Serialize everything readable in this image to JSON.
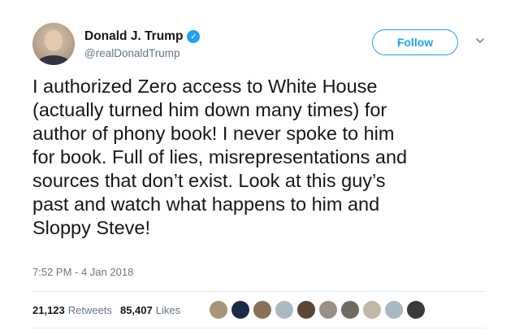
{
  "author": {
    "name": "Donald J. Trump",
    "handle": "@realDonaldTrump",
    "verified_icon": "verified-check-icon",
    "avatar": "profile-avatar"
  },
  "actions": {
    "follow_label": "Follow",
    "menu_icon": "chevron-down-icon"
  },
  "tweet": {
    "lines": [
      "I authorized Zero access to White House",
      "(actually turned him down many times) for",
      "author of phony book! I never spoke to him",
      "for book. Full of lies, misrepresentations and",
      "sources that don’t exist. Look at this guy’s",
      "past and watch what happens to him and",
      "Sloppy Steve!"
    ],
    "timestamp": "7:52 PM - 4 Jan 2018"
  },
  "stats": {
    "retweets_count": "21,123",
    "retweets_label": "Retweets",
    "likes_count": "85,407",
    "likes_label": "Likes"
  },
  "likers": [
    {
      "color": "#a89478"
    },
    {
      "color": "#1c2a4a"
    },
    {
      "color": "#8a6f5a"
    },
    {
      "color": "#aab8c2"
    },
    {
      "color": "#5a4636"
    },
    {
      "color": "#9a8f86"
    },
    {
      "color": "#6f6a62"
    },
    {
      "color": "#c2b7a8"
    },
    {
      "color": "#aab8c2"
    },
    {
      "color": "#3a3a3a"
    }
  ],
  "colors": {
    "accent": "#1da1f2",
    "text": "#14171a",
    "muted": "#657786",
    "divider": "#e6ecf0"
  }
}
